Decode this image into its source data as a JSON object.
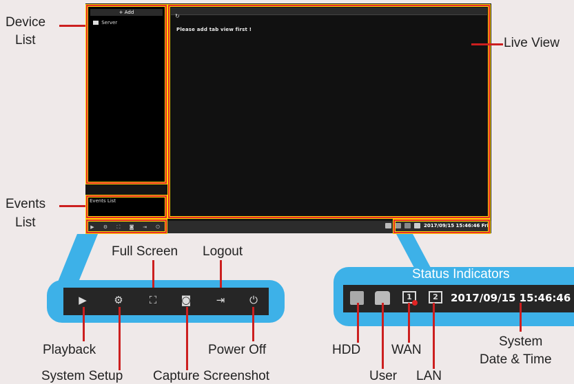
{
  "labels": {
    "device_list_1": "Device",
    "device_list_2": "List",
    "events_list_1": "Events",
    "events_list_2": "List",
    "live_view": "Live View",
    "full_screen": "Full Screen",
    "logout": "Logout",
    "playback": "Playback",
    "system_setup": "System Setup",
    "capture_screenshot": "Capture Screenshot",
    "power_off": "Power Off",
    "status_indicators": "Status Indicators",
    "hdd": "HDD",
    "user": "User",
    "wan": "WAN",
    "lan": "LAN",
    "system_dt_1": "System",
    "system_dt_2": "Date & Time"
  },
  "app": {
    "add_label": "Add",
    "server_label": "Server",
    "events_list_label": "Events List",
    "live_message": "Please add tab view first !",
    "datetime_small": "2017/09/15 15:46:46 Fri",
    "datetime_large": "2017/09/15 15:46:46",
    "wan_num": "1",
    "lan_num": "2"
  },
  "icons": {
    "play": "▶",
    "setup": "⚙",
    "fullscreen": "⛶",
    "capture": "◙",
    "logout": "⇥",
    "power": "⏻",
    "refresh": "↻",
    "plus": "+"
  },
  "colors": {
    "highlight": "#e52b2b",
    "highlight_inner": "#ffd400",
    "callout_bg": "#3db1e8",
    "window_bg": "#151515"
  }
}
